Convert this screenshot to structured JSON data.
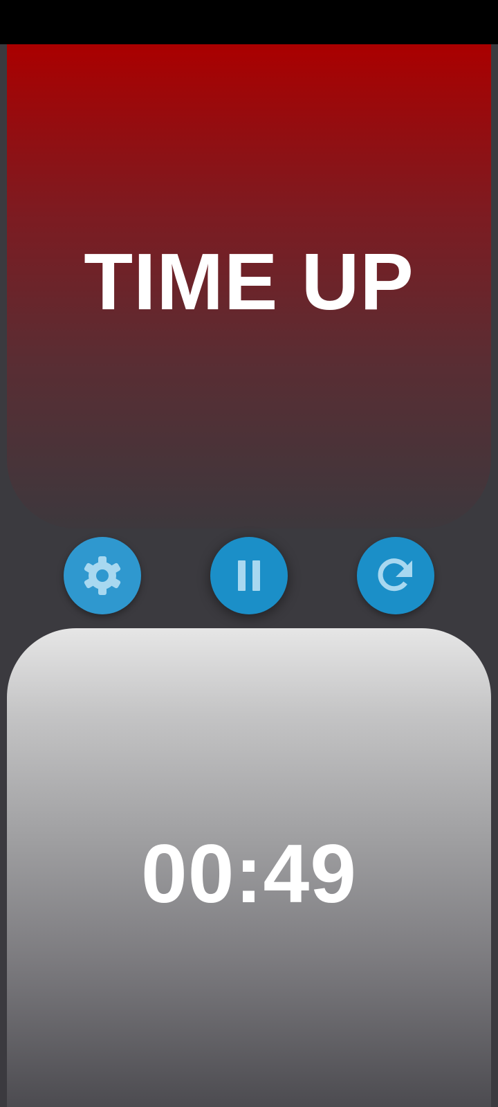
{
  "top_player": {
    "label": "TIME UP"
  },
  "bottom_player": {
    "time": "00:49"
  },
  "controls": {
    "settings_icon": "gear-icon",
    "pause_icon": "pause-icon",
    "reset_icon": "refresh-icon"
  },
  "colors": {
    "time_up_red": "#aa0000",
    "button_blue": "#1b8fc8",
    "icon_light_blue": "#a8d8f0"
  }
}
